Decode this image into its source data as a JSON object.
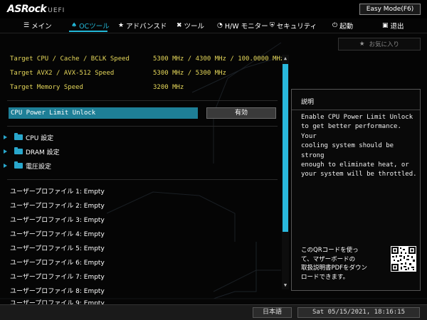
{
  "header": {
    "brand": "ASRock",
    "brand_suffix": "UEFI",
    "mode_button": "Easy Mode(F6)"
  },
  "nav": {
    "items": [
      {
        "label": "メイン",
        "icon": "list-icon"
      },
      {
        "label": "OCツール",
        "icon": "flame-icon"
      },
      {
        "label": "アドバンスド",
        "icon": "star-icon"
      },
      {
        "label": "ツール",
        "icon": "tools-icon"
      },
      {
        "label": "H/W モニター",
        "icon": "gauge-icon"
      },
      {
        "label": "セキュリティ",
        "icon": "shield-icon"
      },
      {
        "label": "起動",
        "icon": "power-icon"
      },
      {
        "label": "退出",
        "icon": "exit-icon"
      }
    ],
    "active_index": 1
  },
  "favorites_button": "お気に入り",
  "info_rows": [
    {
      "label": "Target CPU / Cache / BCLK Speed",
      "value": "5300 MHz / 4300 MHz / 100.0000 MHz"
    },
    {
      "label": "Target AVX2 / AVX-512 Speed",
      "value": "5300 MHz / 5300 MHz"
    },
    {
      "label": "Target Memory Speed",
      "value": "3200 MHz"
    }
  ],
  "selected_setting": {
    "label": "CPU Power Limit Unlock",
    "value": "有効"
  },
  "submenus": [
    {
      "label": "CPU 設定"
    },
    {
      "label": "DRAM 設定"
    },
    {
      "label": "電圧設定"
    }
  ],
  "profiles": [
    "ユーザープロファイル 1: Empty",
    "ユーザープロファイル 2: Empty",
    "ユーザープロファイル 3: Empty",
    "ユーザープロファイル 4: Empty",
    "ユーザープロファイル 5: Empty",
    "ユーザープロファイル 6: Empty",
    "ユーザープロファイル 7: Empty",
    "ユーザープロファイル 8: Empty",
    "ユーザープロファイル 9: Empty"
  ],
  "description": {
    "title": "説明",
    "text": "Enable CPU Power Limit Unlock\nto get better performance. Your\ncooling system should be strong\nenough to eliminate heat, or\nyour system will be throttled.",
    "qr_text": "このQRコードを使っ\nて、マザーボードの\n取扱説明書PDFをダウン\nロードできます。"
  },
  "footer": {
    "language": "日本語",
    "datetime": "Sat 05/15/2021, 18:16:15"
  },
  "colors": {
    "accent": "#23b8d8",
    "highlight": "#1e7f97",
    "value_text": "#e6d85a"
  }
}
